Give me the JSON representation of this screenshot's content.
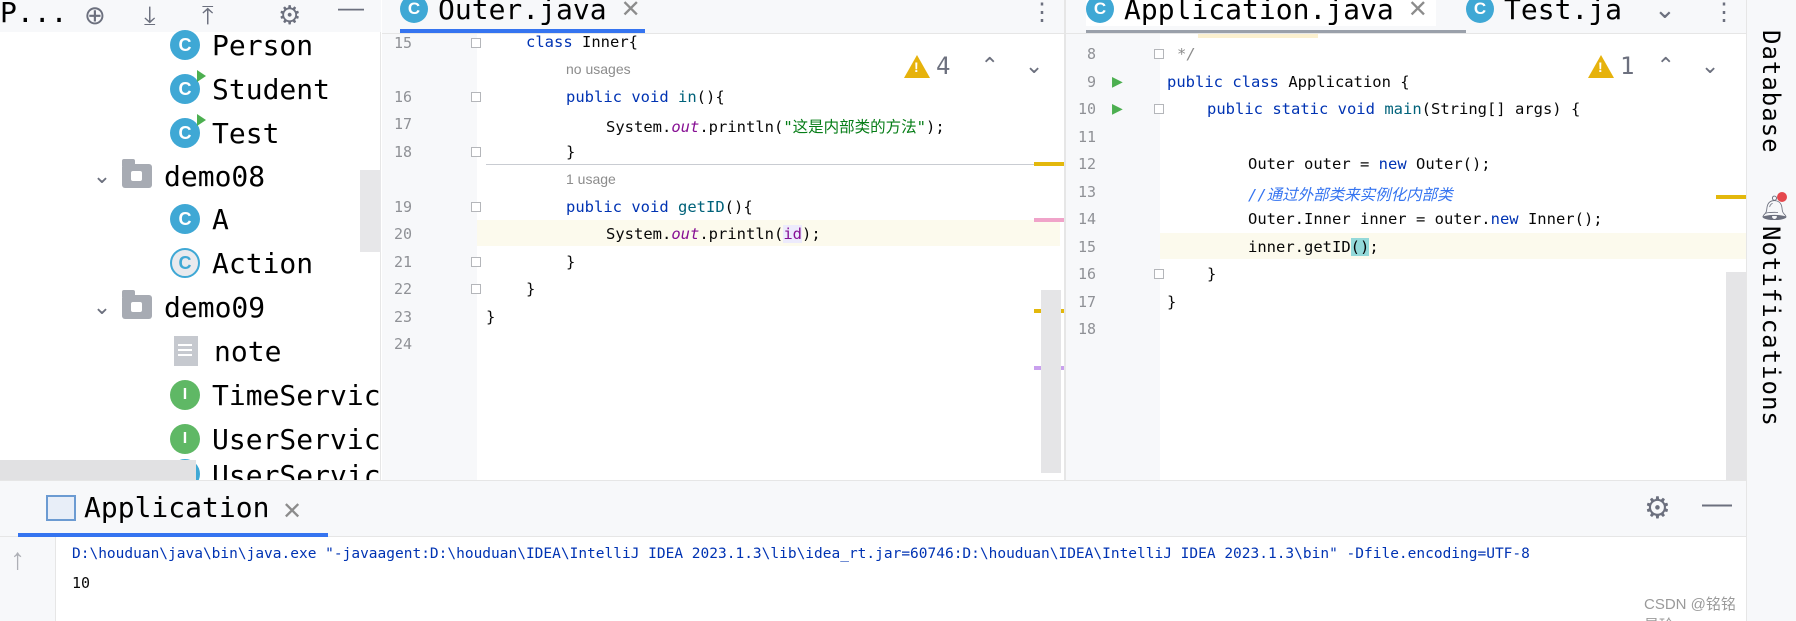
{
  "project_panel": {
    "title": "P...",
    "tree": [
      {
        "label": "Person",
        "kind": "class"
      },
      {
        "label": "Student",
        "kind": "class-run"
      },
      {
        "label": "Test",
        "kind": "class-run"
      },
      {
        "label": "demo08",
        "kind": "folder"
      },
      {
        "label": "A",
        "kind": "class"
      },
      {
        "label": "Action",
        "kind": "class-abstract"
      },
      {
        "label": "demo09",
        "kind": "folder"
      },
      {
        "label": "note",
        "kind": "file"
      },
      {
        "label": "TimeServic",
        "kind": "interface"
      },
      {
        "label": "UserServic",
        "kind": "interface"
      },
      {
        "label": "UserServic",
        "kind": "class"
      }
    ]
  },
  "editor_left": {
    "tab": "Outer.java",
    "warning_count": "4",
    "lines": {
      "n15": "15",
      "n16": "16",
      "n17": "17",
      "n18": "18",
      "n19": "19",
      "n20": "20",
      "n21": "21",
      "n22": "22",
      "n23": "23",
      "n24": "24"
    },
    "hint1": "no usages",
    "hint2": "1 usage",
    "code": {
      "l15_kw": "class",
      "l15_rest": " Inner{",
      "l16_kw": "public void",
      "l16_fn": "in",
      "l16_rest": "(){",
      "l17_a": "System.",
      "l17_out": "out",
      "l17_b": ".println(",
      "l17_str": "\"这是内部类的方法\"",
      "l17_c": ");",
      "l18": "}",
      "l19_kw": "public void",
      "l19_fn": "getID",
      "l19_rest": "(){",
      "l20_a": "System.",
      "l20_out": "out",
      "l20_b": ".println(",
      "l20_id": "id",
      "l20_c": ");",
      "l21": "}",
      "l22": "}",
      "l23": "}"
    }
  },
  "editor_right": {
    "tab": "Application.java",
    "tab2": "Test.ja",
    "warning_count": "1",
    "lines": {
      "n8": "8",
      "n9": "9",
      "n10": "10",
      "n11": "11",
      "n12": "12",
      "n13": "13",
      "n14": "14",
      "n15": "15",
      "n16": "16",
      "n17": "17",
      "n18": "18"
    },
    "code": {
      "l8": "*/",
      "l9_kw": "public class",
      "l9_rest": " Application {",
      "l10_kw": "public static void",
      "l10_fn": "main",
      "l10_rest": "(String[] args) {",
      "l12_a": "Outer outer = ",
      "l12_kw": "new",
      "l12_b": " Outer();",
      "l13": "//通过外部类来实例化内部类",
      "l14_a": "Outer.Inner inner = outer.",
      "l14_kw": "new",
      "l14_b": " Inner();",
      "l15_a": "inner.getID",
      "l15_paren": "()",
      "l15_b": ";",
      "l16": "}",
      "l17": "}"
    }
  },
  "run_panel": {
    "tab": "Application",
    "command": "D:\\houduan\\java\\bin\\java.exe \"-javaagent:D:\\houduan\\IDEA\\IntelliJ IDEA 2023.1.3\\lib\\idea_rt.jar=60746:D:\\houduan\\IDEA\\IntelliJ IDEA 2023.1.3\\bin\" -Dfile.encoding=UTF-8",
    "output": "10"
  },
  "right_sidebar": {
    "database": "Database",
    "notifications": "Notifications"
  },
  "watermark": "CSDN @铭铭是玲"
}
